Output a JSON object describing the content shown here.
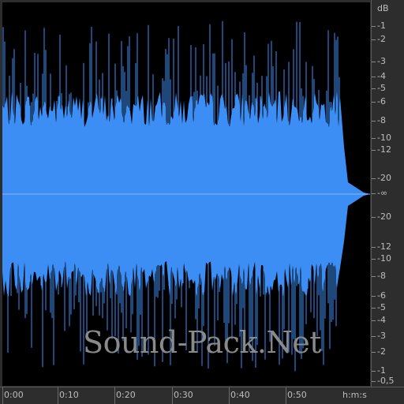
{
  "colors": {
    "wave": "#3c8ef5",
    "wave_bg": "#000000",
    "panel": "#2d2d2d",
    "ruler_text": "#bdbdbd",
    "watermark": "#8a8a8a"
  },
  "watermark": "Sound-Pack.Net",
  "db_scale": {
    "unit_label": "dB",
    "top_labels": [
      "-1",
      "-2",
      "-3",
      "-4",
      "-5",
      "-6",
      "-8",
      "-10",
      "-12",
      "-20"
    ],
    "center_label": "-∞",
    "bottom_labels": [
      "-20",
      "-12",
      "-10",
      "-8",
      "-6",
      "-5",
      "-4",
      "-3",
      "-2",
      "-1",
      "-0,5"
    ]
  },
  "time_axis": {
    "labels": [
      "0:00",
      "0:10",
      "0:20",
      "0:30",
      "0:40",
      "0:50"
    ],
    "unit_label": "h:m:s"
  }
}
